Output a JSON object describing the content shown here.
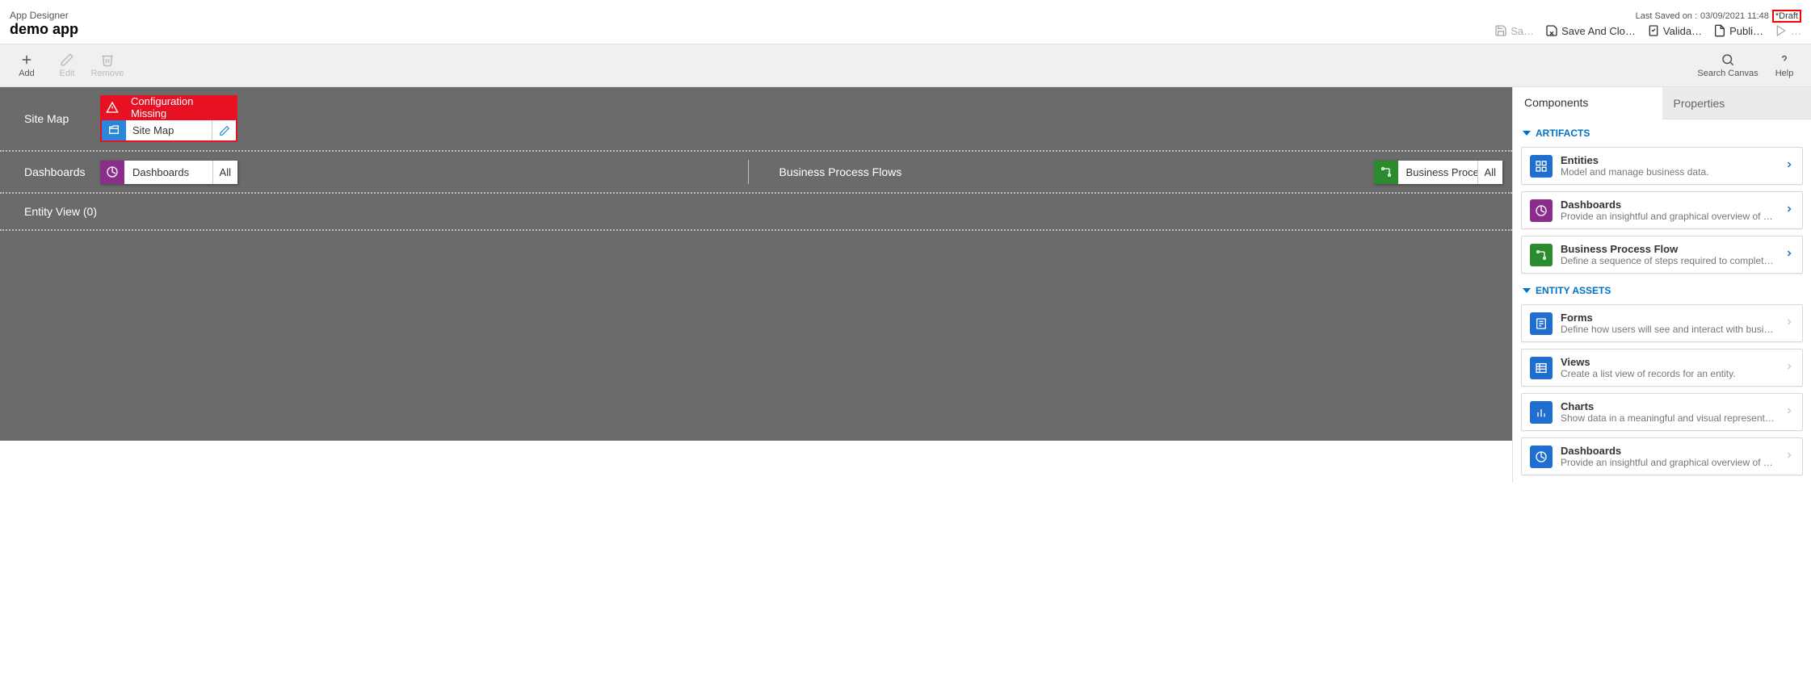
{
  "header": {
    "title": "App Designer",
    "app_name": "demo app",
    "last_saved_prefix": "Last Saved on :",
    "last_saved_value": "03/09/2021 11:48",
    "draft_label": "*Draft",
    "actions": {
      "save": "Sa…",
      "save_close": "Save And Clo…",
      "validate": "Valida…",
      "publish": "Publi…",
      "play": " …"
    }
  },
  "toolbar": {
    "add": "Add",
    "edit": "Edit",
    "remove": "Remove",
    "search": "Search Canvas",
    "help": "Help"
  },
  "canvas": {
    "sitemap_label": "Site Map",
    "config_missing": "Configuration Missing",
    "sitemap_tile": "Site Map",
    "dashboards_label": "Dashboards",
    "dashboards_tile": "Dashboards",
    "all": "All",
    "bpf_label": "Business Process Flows",
    "bpf_tile": "Business Proces…",
    "entity_view": "Entity View (0)"
  },
  "side": {
    "tabs": {
      "components": "Components",
      "properties": "Properties"
    },
    "groups": {
      "artifacts": "ARTIFACTS",
      "entity_assets": "ENTITY ASSETS"
    },
    "cards": {
      "entities": {
        "title": "Entities",
        "desc": "Model and manage business data."
      },
      "dashboards": {
        "title": "Dashboards",
        "desc": "Provide an insightful and graphical overview of …"
      },
      "bpf": {
        "title": "Business Process Flow",
        "desc": "Define a sequence of steps required to complete…"
      },
      "forms": {
        "title": "Forms",
        "desc": "Define how users will see and interact with busin…"
      },
      "views": {
        "title": "Views",
        "desc": "Create a list view of records for an entity."
      },
      "charts": {
        "title": "Charts",
        "desc": "Show data in a meaningful and visual representa…"
      },
      "dashboards2": {
        "title": "Dashboards",
        "desc": "Provide an insightful and graphical overview of …"
      }
    }
  }
}
